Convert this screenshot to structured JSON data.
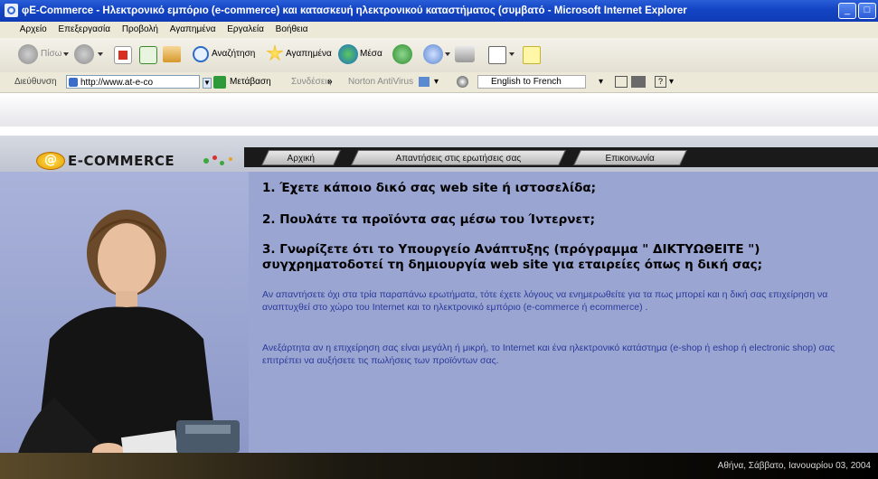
{
  "window": {
    "title": "φE-Commerce - Ηλεκτρονικό εμπόριο (e-commerce) και κατασκευή ηλεκτρονικού καταστήματος (συμβατό - Microsoft Internet Explorer"
  },
  "menu": [
    "Αρχείο",
    "Επεξεργασία",
    "Προβολή",
    "Αγαπημένα",
    "Εργαλεία",
    "Βοήθεια"
  ],
  "toolbar": {
    "back_label": "Πίσω",
    "search_label": "Αναζήτηση",
    "favorites_label": "Αγαπημένα",
    "media_label": "Μέσα"
  },
  "addressbar": {
    "label": "Διεύθυνση",
    "url": "http://www.at-e-co",
    "go_label": "Μετάβαση",
    "links_label": "Συνδέσεις",
    "norton_label": "Norton AntiVirus",
    "translate_option": "English to French"
  },
  "site": {
    "logo_text": "E-COMMERCE",
    "tabs": [
      "Αρχική",
      "Απαντήσεις στις ερωτήσεις σας",
      "Επικοινωνία"
    ],
    "questions": [
      "1. Έχετε κάποιο δικό σας web site ή ιστοσελίδα;",
      "2. Πουλάτε τα προϊόντα σας μέσω του Ίντερνετ;",
      "3. Γνωρίζετε ότι το Υπουργείο Ανάπτυξης (πρόγραμμα \" ΔΙΚΤΥΩΘΕΙΤΕ \")",
      "συγχρηματοδοτεί τη δημιουργία web site για εταιρείες όπως η δική σας;"
    ],
    "paragraphs": [
      "Αν απαντήσετε όχι στα τρία παραπάνω ερωτήματα, τότε έχετε λόγους να ενημερωθείτε για τα πως μπορεί και η δική σας επιχείρηση να αναπτυχθεί στο χώρο του Internet και το ηλεκτρονικό εμπόριο (e-commerce ή ecommerce) .",
      "Ανεξάρτητα αν η επιχείρηση σας είναι μεγάλη ή μικρή, το Internet και ένα ηλεκτρονικό κατάστημα (e-shop ή eshop ή electronic shop) σας επιτρέπει να αυξήσετε τις πωλήσεις των προϊόντων σας."
    ],
    "footer_date": "Αθήνα, Σάββατο, Ιανουαρίου 03, 2004"
  }
}
